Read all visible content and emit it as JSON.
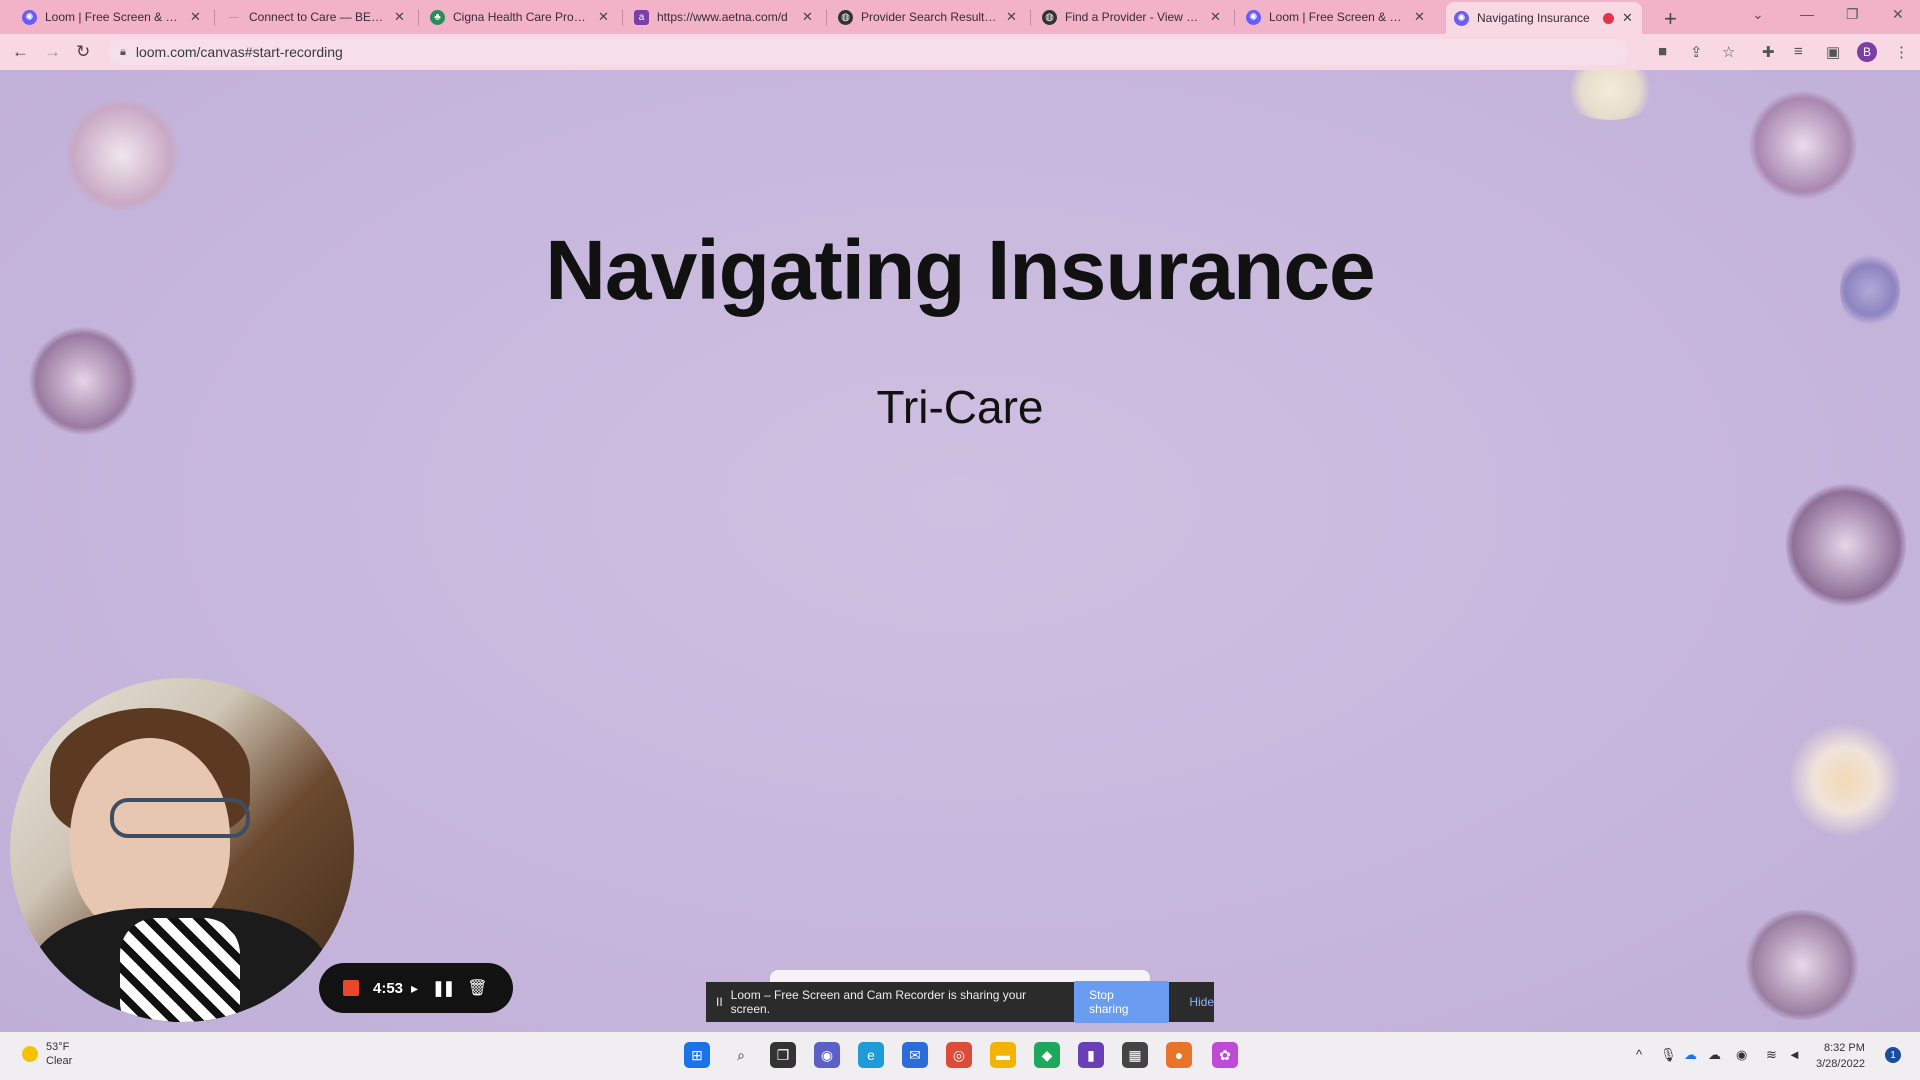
{
  "browser": {
    "tabs": [
      {
        "title": "Loom | Free Screen & Vide",
        "favicon": "loom-icon",
        "color": "#6a5cf6"
      },
      {
        "title": "Connect to Care — BEMor",
        "favicon": "dash-icon",
        "color": "#999999"
      },
      {
        "title": "Cigna Health Care Provide",
        "favicon": "cigna-tree-icon",
        "color": "#2e8b57"
      },
      {
        "title": "https://www.aetna.com/d",
        "favicon": "aetna-a-icon",
        "color": "#7b3fa6"
      },
      {
        "title": "Provider Search Results | A",
        "favicon": "globe-icon",
        "color": "#333333"
      },
      {
        "title": "Find a Provider - View Res",
        "favicon": "globe-icon",
        "color": "#333333"
      },
      {
        "title": "Loom | Free Screen & Vide",
        "favicon": "loom-icon",
        "color": "#6a5cf6"
      },
      {
        "title": "Navigating Insurance",
        "favicon": "loom-icon",
        "color": "#6a5cf6",
        "active": true,
        "recording": true
      }
    ],
    "url": "loom.com/canvas#start-recording",
    "profile_initial": "B"
  },
  "slide": {
    "title": "Navigating Insurance",
    "subtitle": "Tri-Care"
  },
  "recorder": {
    "elapsed": "4:53"
  },
  "share_notice": {
    "message": "Loom – Free Screen and Cam Recorder is sharing your screen.",
    "stop_label": "Stop sharing",
    "hide_label": "Hide",
    "pause_glyph": "II"
  },
  "taskbar": {
    "weather_temp": "53°F",
    "weather_desc": "Clear",
    "time": "8:32 PM",
    "date": "3/28/2022",
    "notification_count": "1"
  }
}
